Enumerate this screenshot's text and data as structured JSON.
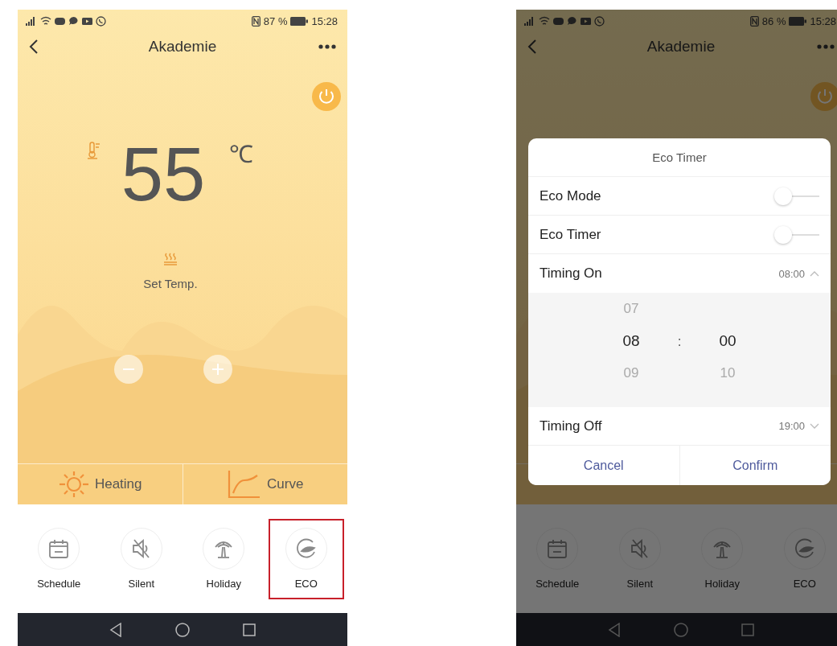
{
  "screens": [
    {
      "status_bar": {
        "battery": "87 %",
        "time": "15:28"
      },
      "header": {
        "title": "Akademie"
      },
      "temperature": {
        "value": "55",
        "unit": "℃",
        "label": "Set Temp."
      },
      "modes": [
        {
          "label": "Heating"
        },
        {
          "label": "Curve"
        }
      ],
      "functions": [
        {
          "label": "Schedule",
          "highlighted": false
        },
        {
          "label": "Silent",
          "highlighted": false
        },
        {
          "label": "Holiday",
          "highlighted": false
        },
        {
          "label": "ECO",
          "highlighted": true
        }
      ]
    },
    {
      "status_bar": {
        "battery": "86 %",
        "time": "15:28"
      },
      "header": {
        "title": "Akademie"
      },
      "functions": [
        {
          "label": "Schedule",
          "highlighted": false
        },
        {
          "label": "Silent",
          "highlighted": false
        },
        {
          "label": "Holiday",
          "highlighted": false
        },
        {
          "label": "ECO",
          "highlighted": false
        }
      ],
      "dialog": {
        "title": "Eco Timer",
        "rows": [
          {
            "kind": "switch",
            "label": "Eco Mode",
            "on": false
          },
          {
            "kind": "switch",
            "label": "Eco Timer",
            "on": false
          },
          {
            "kind": "time",
            "label": "Timing On",
            "value": "08:00",
            "expanded": true
          },
          {
            "kind": "picker",
            "separator": ":",
            "columns": [
              {
                "items": [
                  {
                    "text": "07",
                    "selected": false
                  },
                  {
                    "text": "08",
                    "selected": true
                  },
                  {
                    "text": "09",
                    "selected": false
                  }
                ]
              },
              {
                "items": [
                  {
                    "text": "00",
                    "selected": true
                  },
                  {
                    "text": "10",
                    "selected": false
                  }
                ]
              }
            ]
          },
          {
            "kind": "time",
            "label": "Timing Off",
            "value": "19:00",
            "expanded": false
          }
        ],
        "buttons": [
          "Cancel",
          "Confirm"
        ]
      }
    }
  ]
}
